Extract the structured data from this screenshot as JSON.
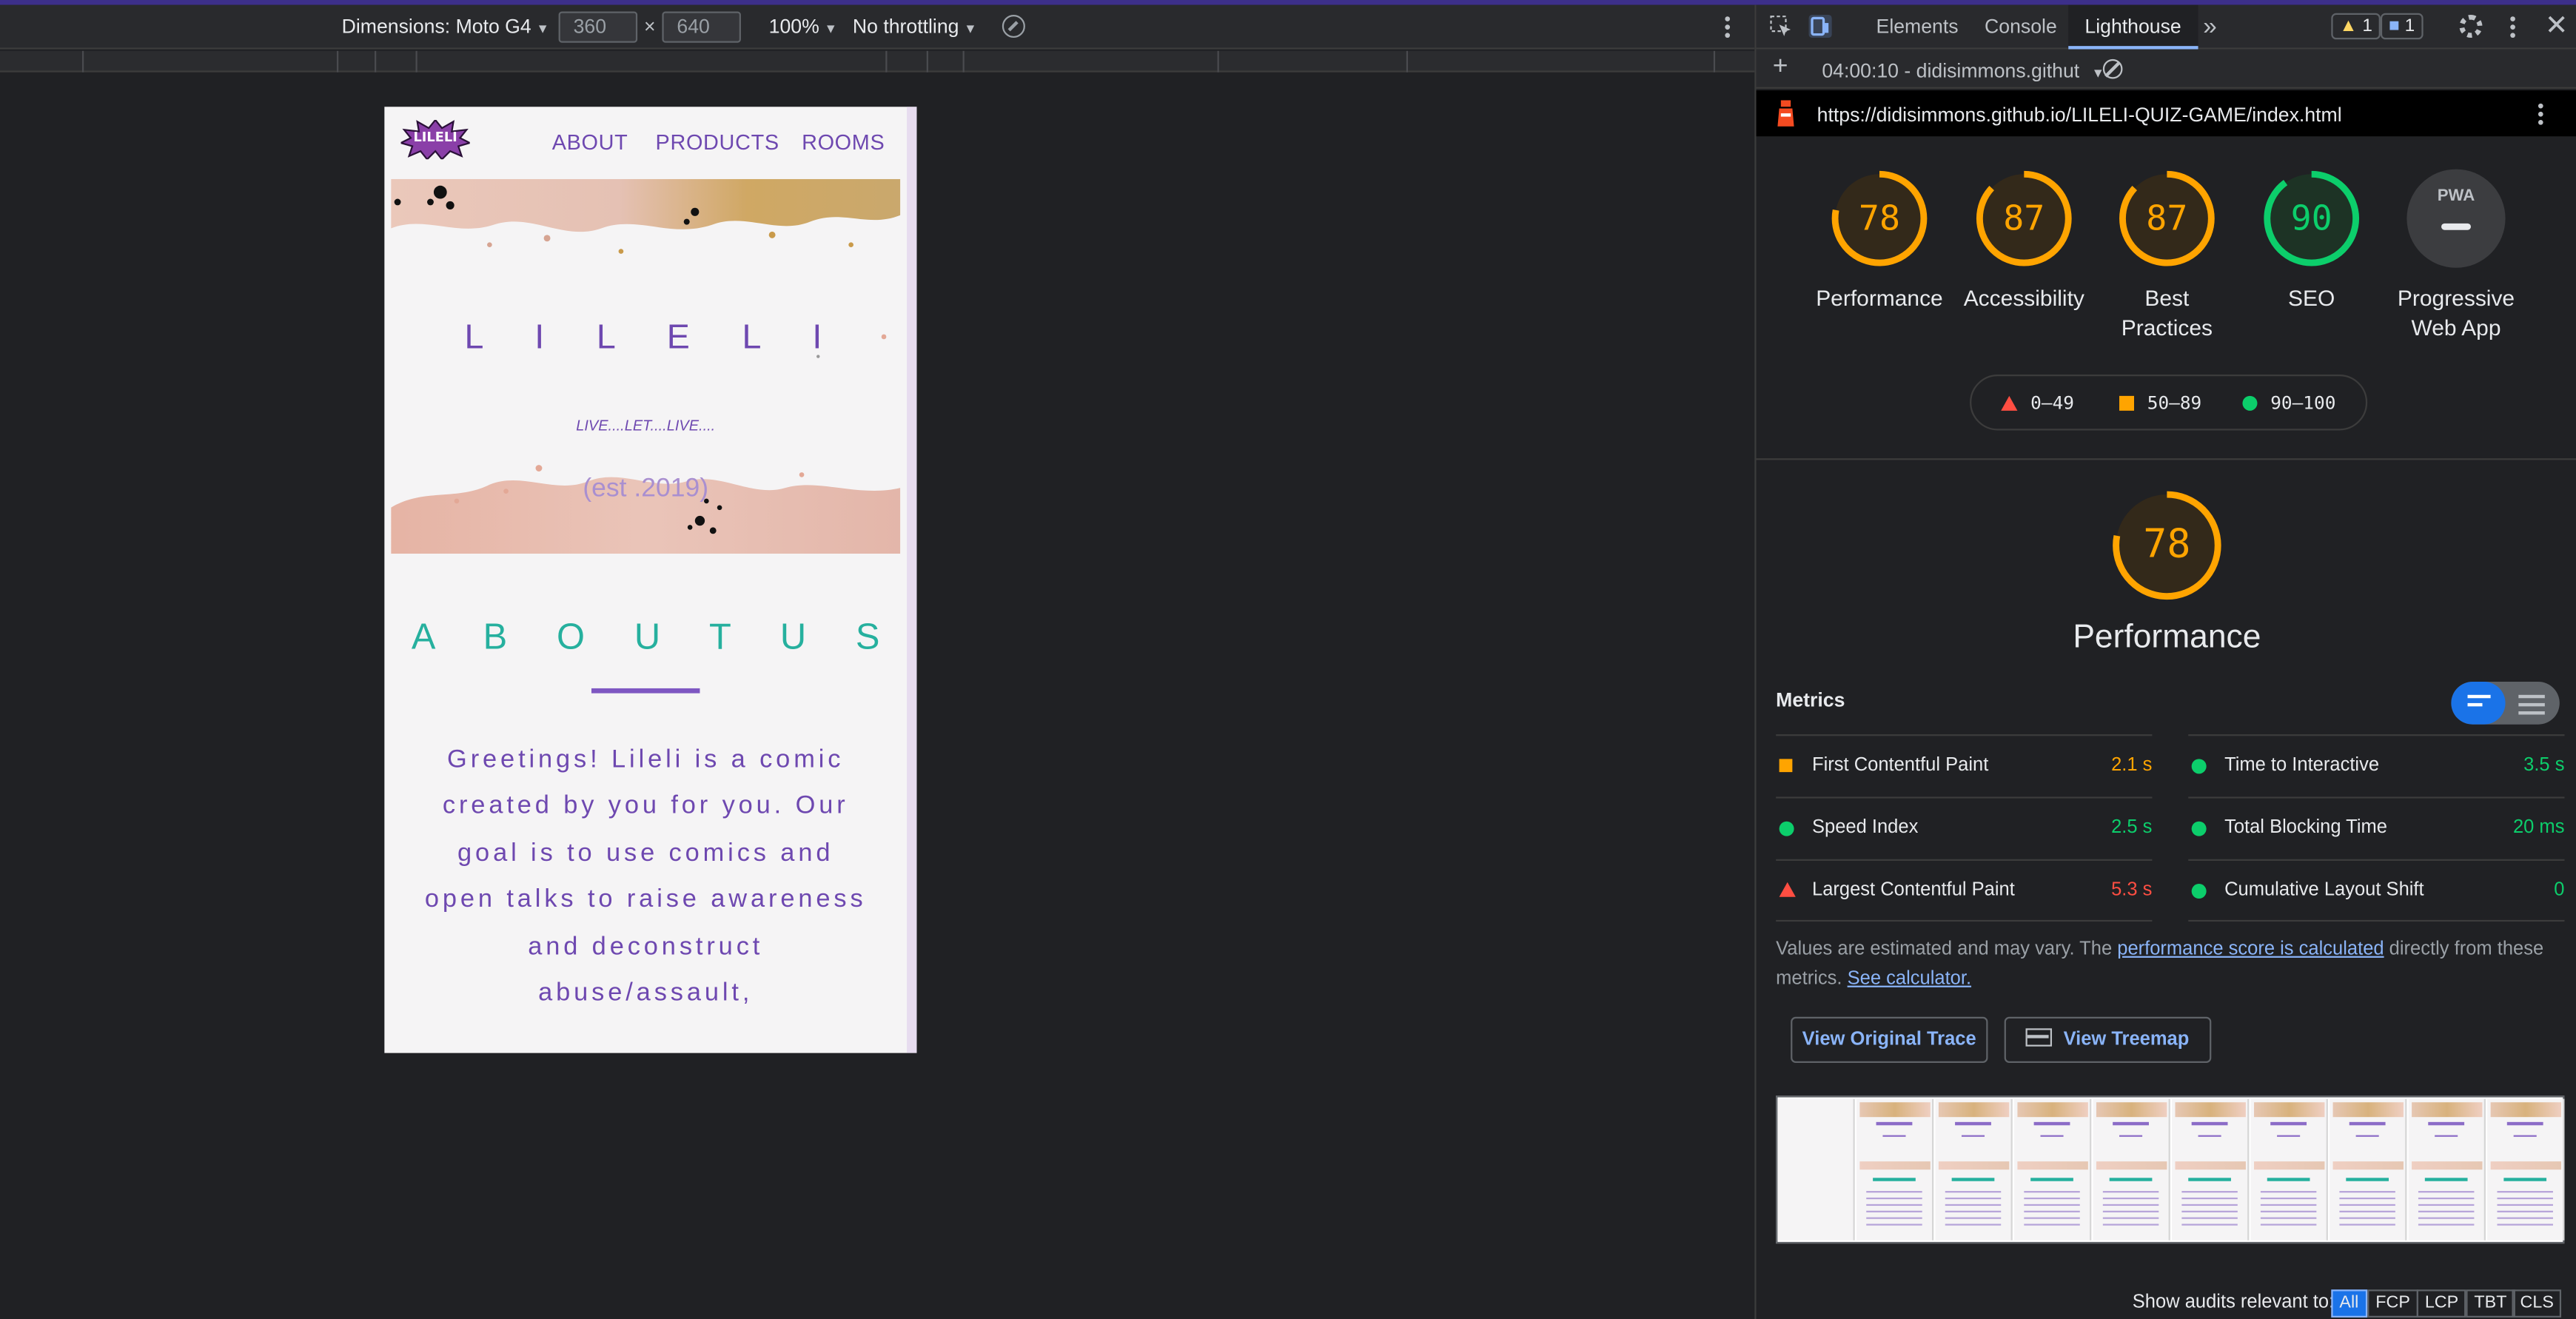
{
  "device_toolbar": {
    "dimensions_label": "Dimensions: Moto G4",
    "width_value": "360",
    "times": "×",
    "height_value": "640",
    "zoom": "100%",
    "throttling": "No throttling"
  },
  "site": {
    "logo_text": "LILELI",
    "nav": [
      "ABOUT",
      "PRODUCTS",
      "ROOMS"
    ],
    "hero_title": "L I L E L I",
    "hero_subtitle": "LIVE....LET....LIVE....",
    "hero_est": "(est .2019)",
    "about_title": "A B O U T   U S",
    "about_text": "Greetings! Lileli is a comic created by you for you. Our goal is to use comics and open talks to raise awareness and deconstruct abuse/assault,"
  },
  "devtools": {
    "tabs": [
      "Elements",
      "Console",
      "Lighthouse"
    ],
    "more_tabs": "»",
    "warnings_count": "1",
    "messages_count": "1",
    "report_selector": "04:00:10 - didisimmons.githut",
    "url": "https://didisimmons.github.io/LILELI-QUIZ-GAME/index.html",
    "pwa_abbr": "PWA"
  },
  "lighthouse": {
    "categories": [
      {
        "label": "Performance",
        "score": 78,
        "color": "#ffa400"
      },
      {
        "label": "Accessibility",
        "score": 87,
        "color": "#ffa400"
      },
      {
        "label": "Best Practices",
        "score": 87,
        "color": "#ffa400"
      },
      {
        "label": "SEO",
        "score": 90,
        "color": "#0cce6b"
      },
      {
        "label": "Progressive Web App",
        "score": null,
        "color": "#bdc1c6"
      }
    ],
    "legend": [
      "0–49",
      "50–89",
      "90–100"
    ],
    "perf_score": "78",
    "perf_title": "Performance",
    "metrics_header": "Metrics",
    "metrics": [
      {
        "name": "First Contentful Paint",
        "value": "2.1 s",
        "status": "average",
        "color": "#ffa400"
      },
      {
        "name": "Time to Interactive",
        "value": "3.5 s",
        "status": "pass",
        "color": "#0cce6b"
      },
      {
        "name": "Speed Index",
        "value": "2.5 s",
        "status": "pass",
        "color": "#0cce6b"
      },
      {
        "name": "Total Blocking Time",
        "value": "20 ms",
        "status": "pass",
        "color": "#0cce6b"
      },
      {
        "name": "Largest Contentful Paint",
        "value": "5.3 s",
        "status": "fail",
        "color": "#ff4e42"
      },
      {
        "name": "Cumulative Layout Shift",
        "value": "0",
        "status": "pass",
        "color": "#0cce6b"
      }
    ],
    "note_prefix": "Values are estimated and may vary. The ",
    "note_link": "performance score is calculated",
    "note_mid": " directly from these metrics. ",
    "note_link2": "See calculator.",
    "view_trace": "View Original Trace",
    "view_treemap": "View Treemap",
    "show_audits": "Show audits relevant to:",
    "audit_filters": [
      "All",
      "FCP",
      "LCP",
      "TBT",
      "CLS"
    ]
  }
}
